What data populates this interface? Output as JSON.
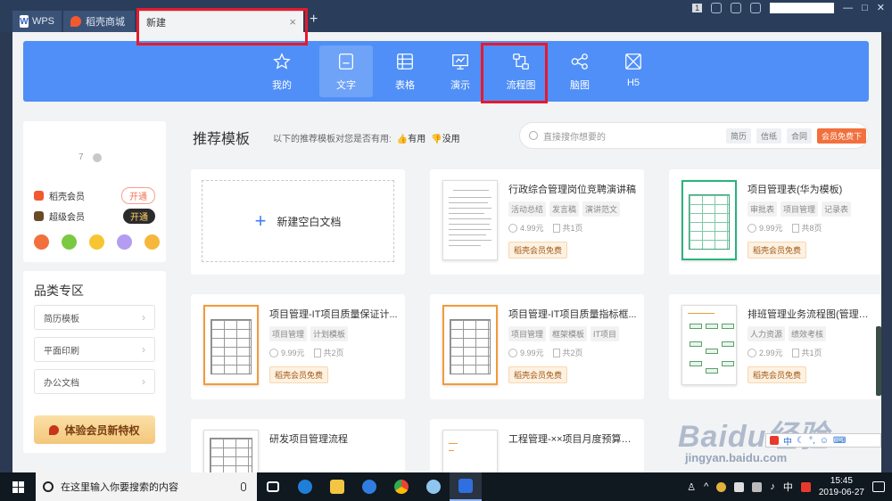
{
  "titlebar": {
    "tabs": [
      {
        "label": "WPS"
      },
      {
        "label": "稻壳商城"
      },
      {
        "label": "新建",
        "close": "×"
      }
    ],
    "add_tab": "+",
    "badge": "1",
    "controls": {
      "minimize": "—",
      "maximize": "□",
      "close": "✕"
    }
  },
  "categories": [
    {
      "label": "我的",
      "icon": "star-icon"
    },
    {
      "label": "文字",
      "icon": "document-icon",
      "active": true
    },
    {
      "label": "表格",
      "icon": "table-icon"
    },
    {
      "label": "演示",
      "icon": "presentation-icon"
    },
    {
      "label": "流程图",
      "icon": "flowchart-icon"
    },
    {
      "label": "脑图",
      "icon": "mindmap-icon"
    },
    {
      "label": "H5",
      "icon": "h5-icon"
    }
  ],
  "user": {
    "name": "7",
    "memberships": [
      {
        "label": "稻壳会员",
        "button": "开通",
        "color": "#f2592e"
      },
      {
        "label": "超级会员",
        "button": "开通",
        "color": "#6b4a26"
      }
    ],
    "quick_icon_colors": [
      "#f2703d",
      "#7ac943",
      "#f7c531",
      "#b39cf2",
      "#f6b73c"
    ]
  },
  "category_zone": {
    "title": "品类专区",
    "items": [
      "简历模板",
      "平面印刷",
      "办公文档"
    ],
    "vip_button": "体验会员新特权"
  },
  "recommend": {
    "title": "推荐模板",
    "hint": "以下的推荐模板对您是否有用:",
    "useful": "有用",
    "useless": "没用"
  },
  "search": {
    "placeholder": "直接搜你想要的",
    "tags": [
      "简历",
      "信纸",
      "合同"
    ],
    "promo": "会员免费下"
  },
  "new_blank": {
    "plus": "+",
    "label": "新建空白文档"
  },
  "templates": [
    {
      "title": "行政综合管理岗位竞聘演讲稿",
      "tags": [
        "活动总结",
        "发言稿",
        "演讲范文"
      ],
      "price": "4.99元",
      "pages": "共1页",
      "free": "稻壳会员免费"
    },
    {
      "title": "项目管理表(华为模板)",
      "tags": [
        "审批表",
        "项目管理",
        "记录表"
      ],
      "price": "9.99元",
      "pages": "共8页",
      "free": "稻壳会员免费"
    },
    {
      "title": "项目管理-IT项目质量保证计...",
      "tags": [
        "项目管理",
        "计划模板"
      ],
      "price": "9.99元",
      "pages": "共2页",
      "free": "稻壳会员免费"
    },
    {
      "title": "项目管理-IT项目质量指标框...",
      "tags": [
        "项目管理",
        "框架模板",
        "IT项目"
      ],
      "price": "9.99元",
      "pages": "共2页",
      "free": "稻壳会员免费"
    },
    {
      "title": "排班管理业务流程图(管理实...",
      "tags": [
        "人力资源",
        "绩效考核"
      ],
      "price": "2.99元",
      "pages": "共1页",
      "free": "稻壳会员免费"
    },
    {
      "title": "研发项目管理流程"
    },
    {
      "title": "工程管理-××项目月度预算执..."
    }
  ],
  "watermark": {
    "logo": "Baidu经验",
    "url": "jingyan.baidu.com"
  },
  "ime": {
    "lang": "中"
  },
  "taskbar": {
    "search_placeholder": "在这里输入你要搜索的内容",
    "tray_lang": "中",
    "time": "15:45",
    "date": "2019-06-27"
  }
}
